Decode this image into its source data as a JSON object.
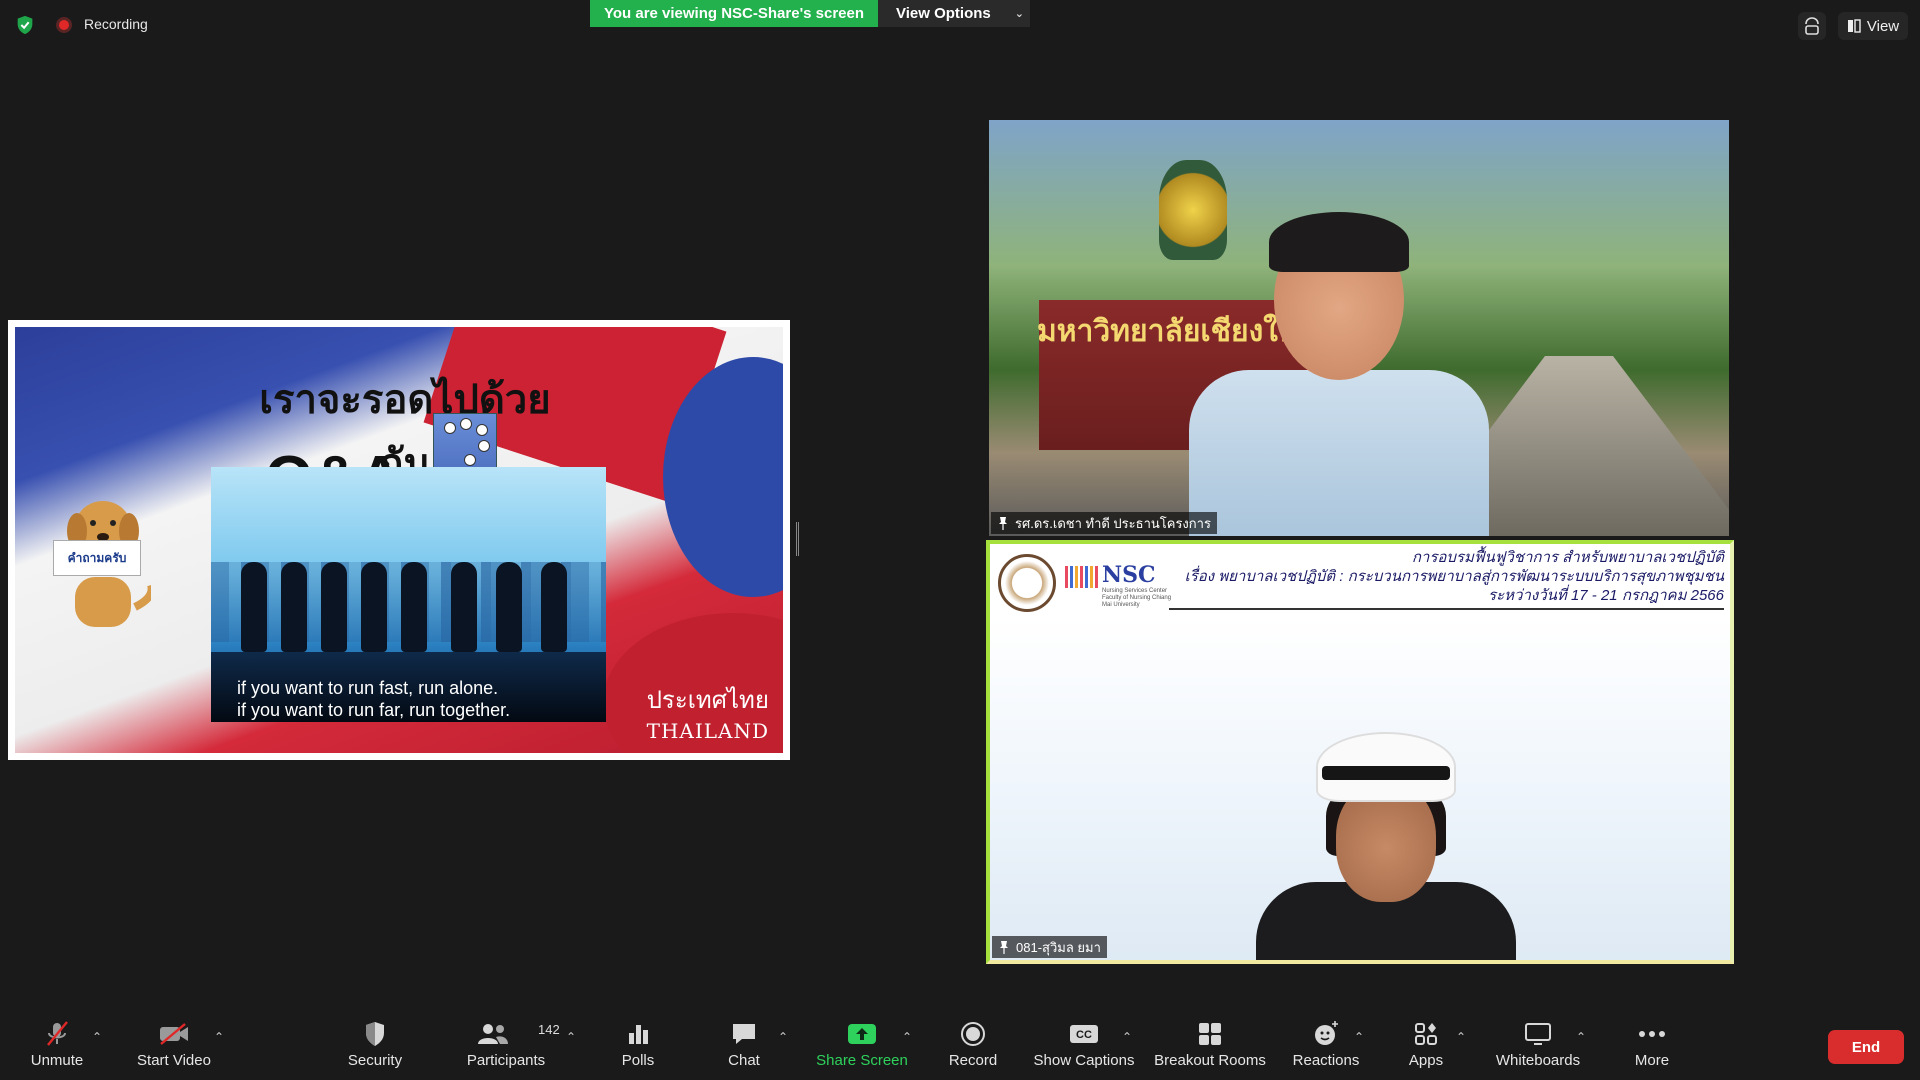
{
  "top_bar": {
    "recording_label": "Recording",
    "viewing_banner": "You are viewing NSC-Share's screen",
    "view_options_label": "View Options",
    "view_label": "View"
  },
  "shared_slide": {
    "heading": "เราจะรอดไปด้วยกัน",
    "qa": "Q&A",
    "dog_sign": "คำถามครับ",
    "quote_line1": "if you want to run fast, run alone.",
    "quote_line2": "if you want to run far, run together.",
    "country_th": "ประเทศไทย",
    "country_en": "THAILAND"
  },
  "tiles": [
    {
      "name": "รศ.ดร.เดชา ทำดี ประธานโครงการ",
      "gate_text": "มหาวิทยาลัยเชียงใหม่"
    },
    {
      "name": "081-สุวิมล ยมา",
      "banner_line1": "การอบรมฟื้นฟูวิชาการ สำหรับพยาบาลเวชปฏิบัติ",
      "banner_line2": "เรื่อง พยาบาลเวชปฏิบัติ : กระบวนการพยาบาลสู่การพัฒนาระบบบริการสุขภาพชุมชน",
      "banner_line3": "ระหว่างวันที่ 17 - 21 กรกฎาคม 2566",
      "nsc_logo": "NSC",
      "nsc_sub": "Nursing Services Center Faculty of Nursing Chiang Mai University"
    }
  ],
  "toolbar": {
    "unmute": "Unmute",
    "start_video": "Start Video",
    "security": "Security",
    "participants": "Participants",
    "participants_count": "142",
    "polls": "Polls",
    "chat": "Chat",
    "share_screen": "Share Screen",
    "record": "Record",
    "show_captions": "Show Captions",
    "breakout_rooms": "Breakout Rooms",
    "reactions": "Reactions",
    "apps": "Apps",
    "whiteboards": "Whiteboards",
    "more": "More",
    "end": "End"
  },
  "colors": {
    "green_banner": "#22b14c",
    "end_red": "#d92c2c",
    "share_green": "#2ed15b",
    "active_speaker_border": "#a6e03c"
  }
}
